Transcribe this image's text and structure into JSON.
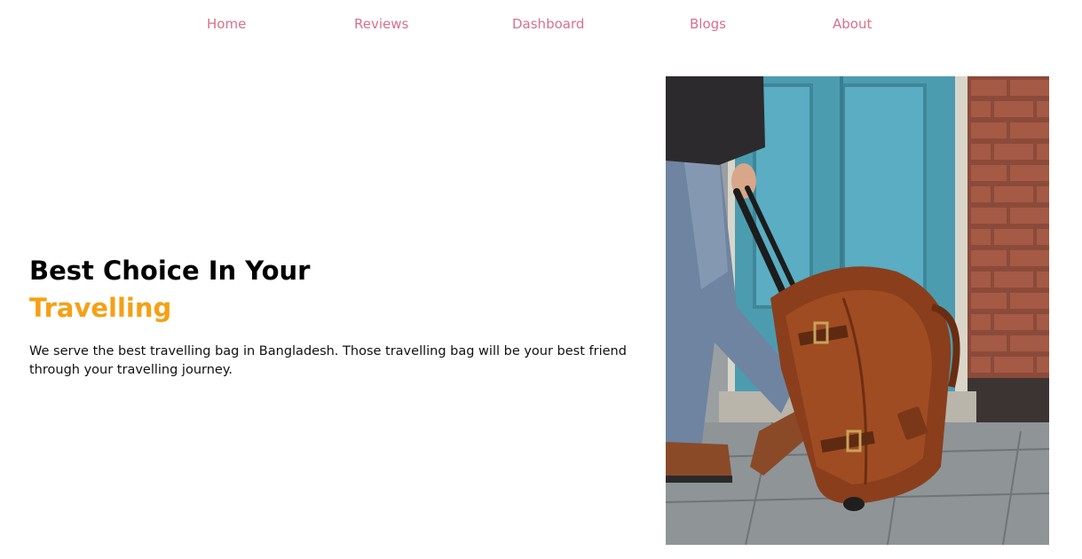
{
  "nav": {
    "items": [
      {
        "label": "Home"
      },
      {
        "label": "Reviews"
      },
      {
        "label": "Dashboard"
      },
      {
        "label": "Blogs"
      },
      {
        "label": "About"
      }
    ],
    "color": "#d9708a"
  },
  "hero": {
    "title_line1": "Best Choice In Your",
    "title_line2": "Travelling",
    "description": "We serve the best travelling bag in Bangladesh. Those travelling bag will be your best friend through your travelling journey.",
    "accent_color": "#f5a015"
  },
  "image": {
    "icon": "travel-bag-photo"
  }
}
